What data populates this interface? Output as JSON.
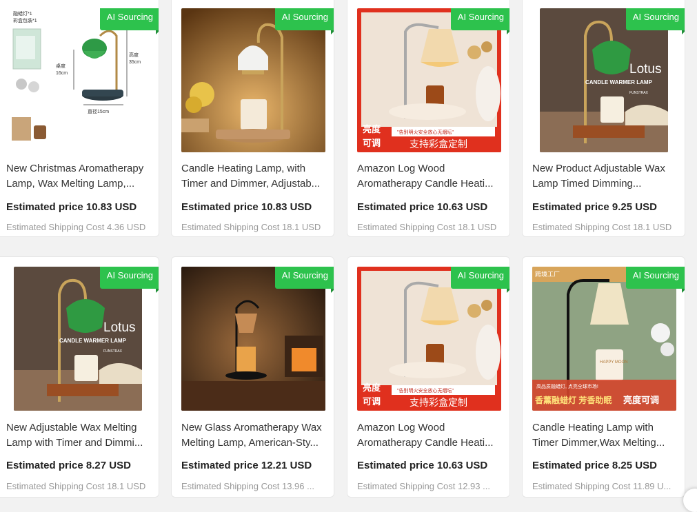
{
  "badge_label": "AI Sourcing",
  "colors": {
    "badge": "#2dc24d",
    "price_text": "#222222",
    "shipping_text": "#999999"
  },
  "products": [
    {
      "title": "New Christmas Aromatherapy Lamp, Wax Melting Lamp,...",
      "price": "Estimated price 10.83 USD",
      "shipping": "Estimated Shipping Cost 4.36 USD",
      "image_text": [
        "融蜡灯*1",
        "彩盒包装*1",
        "高度",
        "35cm",
        "桌度",
        "16cm",
        "直径15cm"
      ]
    },
    {
      "title": "Candle Heating Lamp, with Timer and Dimmer, Adjustab...",
      "price": "Estimated price 10.83 USD",
      "shipping": "Estimated Shipping Cost 18.1 USD",
      "image_text": []
    },
    {
      "title": "Amazon Log Wood Aromatherapy Candle Heati...",
      "price": "Estimated price 10.63 USD",
      "shipping": "Estimated Shipping Cost 18.1 USD",
      "image_text": [
        "亮度",
        "可调",
        "支持彩盒定制",
        "\"告别明火安全放心无烟坛\""
      ]
    },
    {
      "title": "New Product Adjustable Wax Lamp Timed Dimming...",
      "price": "Estimated price 9.25 USD",
      "shipping": "Estimated Shipping Cost 18.1 USD",
      "image_text": [
        "Lotus",
        "CANDLE WARMER LAMP",
        "FUNSTRAX"
      ]
    },
    {
      "title": "New Adjustable Wax Melting Lamp with Timer and Dimmi...",
      "price": "Estimated price 8.27 USD",
      "shipping": "Estimated Shipping Cost 18.1 USD",
      "image_text": [
        "Lotus",
        "CANDLE WARMER LAMP",
        "FUNSTRAX"
      ]
    },
    {
      "title": "New Glass Aromatherapy Wax Melting Lamp, American-Sty...",
      "price": "Estimated price 12.21 USD",
      "shipping": "Estimated Shipping Cost 13.96 ...",
      "image_text": []
    },
    {
      "title": "Amazon Log Wood Aromatherapy Candle Heati...",
      "price": "Estimated price 10.63 USD",
      "shipping": "Estimated Shipping Cost 12.93 ...",
      "image_text": [
        "亮度",
        "可调",
        "支持彩盒定制",
        "\"告别明火安全放心无烟坛\""
      ]
    },
    {
      "title": "Candle Heating Lamp with Timer Dimmer,Wax Melting...",
      "price": "Estimated price 8.25 USD",
      "shipping": "Estimated Shipping Cost 11.89 U...",
      "image_text": [
        "跨境工厂",
        "高品质融蜡灯, 点亮全球市场!",
        "香薰融蜡灯 芳香助眠",
        "亮度可调",
        "HAPPY MOON"
      ]
    }
  ]
}
